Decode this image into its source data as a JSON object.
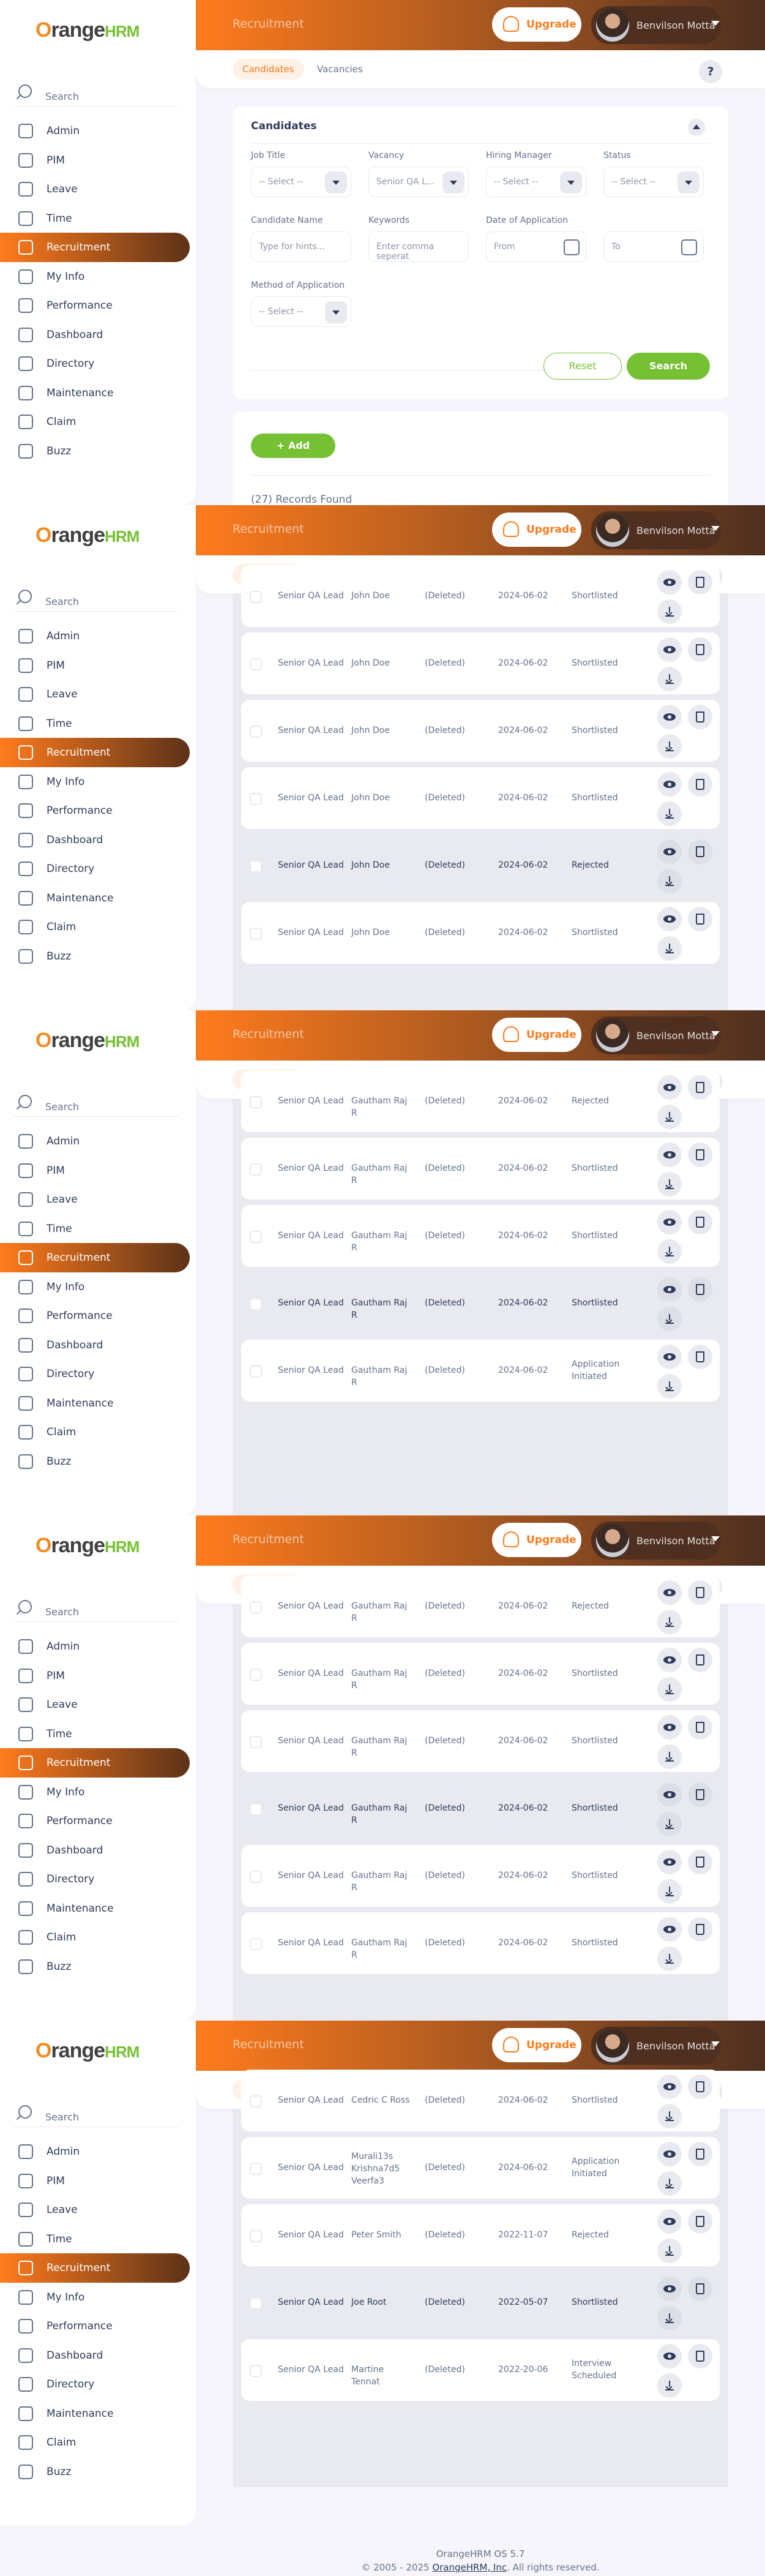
{
  "app": {
    "brand_word": "range",
    "brand_suffix": "HRM",
    "module_title": "Recruitment",
    "upgrade_label": "Upgrade",
    "user_name": "Benvilson Motta",
    "help_label": "?",
    "search_placeholder": "Search",
    "menu": [
      "Admin",
      "PIM",
      "Leave",
      "Time",
      "Recruitment",
      "My Info",
      "Performance",
      "Dashboard",
      "Directory",
      "Maintenance",
      "Claim",
      "Buzz"
    ],
    "active_menu": "Recruitment",
    "tabs": [
      "Candidates",
      "Vacancies"
    ]
  },
  "filters": {
    "title": "Candidates",
    "job_title_label": "Job Title",
    "job_title_value": "-- Select --",
    "vacancy_label": "Vacancy",
    "vacancy_value": "Senior QA L...",
    "hiring_manager_label": "Hiring Manager",
    "hiring_manager_value": "-- Select --",
    "status_label": "Status",
    "status_value": "-- Select --",
    "candidate_name_label": "Candidate Name",
    "candidate_name_placeholder": "Type for hints...",
    "keywords_label": "Keywords",
    "keywords_placeholder": "Enter comma seperat",
    "date_label": "Date of Application",
    "date_from": "From",
    "date_to": "To",
    "method_label": "Method of Application",
    "method_value": "-- Select --",
    "reset_label": "Reset",
    "search_label": "Search"
  },
  "list": {
    "add_label": "+ Add",
    "records_found": "(27) Records Found"
  },
  "frames": [
    {
      "rows": []
    },
    {
      "rows": [
        [
          "Senior QA Lead",
          "John Doe",
          "(Deleted)",
          "2024-06-02",
          "Shortlisted"
        ],
        [
          "Senior QA Lead",
          "John Doe",
          "(Deleted)",
          "2024-06-02",
          "Shortlisted"
        ],
        [
          "Senior QA Lead",
          "John Doe",
          "(Deleted)",
          "2024-06-02",
          "Shortlisted"
        ],
        [
          "Senior QA Lead",
          "John Doe",
          "(Deleted)",
          "2024-06-02",
          "Shortlisted"
        ],
        [
          "Senior QA Lead",
          "John Doe",
          "(Deleted)",
          "2024-06-02",
          "Rejected"
        ],
        [
          "Senior QA Lead",
          "John Doe",
          "(Deleted)",
          "2024-06-02",
          "Shortlisted"
        ]
      ]
    },
    {
      "rows": [
        [
          "Senior QA Lead",
          "Gautham Raj R",
          "(Deleted)",
          "2024-06-02",
          "Rejected"
        ],
        [
          "Senior QA Lead",
          "Gautham Raj R",
          "(Deleted)",
          "2024-06-02",
          "Shortlisted"
        ],
        [
          "Senior QA Lead",
          "Gautham Raj R",
          "(Deleted)",
          "2024-06-02",
          "Shortlisted"
        ],
        [
          "Senior QA Lead",
          "Gautham Raj R",
          "(Deleted)",
          "2024-06-02",
          "Shortlisted"
        ],
        [
          "Senior QA Lead",
          "Gautham Raj R",
          "(Deleted)",
          "2024-06-02",
          "Application Initiated"
        ]
      ]
    },
    {
      "rows": [
        [
          "Senior QA Lead",
          "Gautham Raj R",
          "(Deleted)",
          "2024-06-02",
          "Rejected"
        ],
        [
          "Senior QA Lead",
          "Gautham Raj R",
          "(Deleted)",
          "2024-06-02",
          "Shortlisted"
        ],
        [
          "Senior QA Lead",
          "Gautham Raj R",
          "(Deleted)",
          "2024-06-02",
          "Shortlisted"
        ],
        [
          "Senior QA Lead",
          "Gautham Raj R",
          "(Deleted)",
          "2024-06-02",
          "Shortlisted"
        ],
        [
          "Senior QA Lead",
          "Gautham Raj R",
          "(Deleted)",
          "2024-06-02",
          "Shortlisted"
        ],
        [
          "Senior QA Lead",
          "Gautham Raj R",
          "(Deleted)",
          "2024-06-02",
          "Shortlisted"
        ]
      ]
    },
    {
      "rows": [
        [
          "Senior QA Lead",
          "Cedric C Ross",
          "(Deleted)",
          "2024-06-02",
          "Shortlisted"
        ],
        [
          "Senior QA Lead",
          "Murali13s Krishna7d5 Veerfa3",
          "(Deleted)",
          "2024-06-02",
          "Application Initiated"
        ],
        [
          "Senior QA Lead",
          "Peter Smith",
          "(Deleted)",
          "2022-11-07",
          "Rejected"
        ],
        [
          "Senior QA Lead",
          "Joe Root",
          "(Deleted)",
          "2022-05-07",
          "Shortlisted"
        ],
        [
          "Senior QA Lead",
          "Martine Tennat",
          "(Deleted)",
          "2022-20-06",
          "Interview Scheduled"
        ]
      ]
    }
  ],
  "footer": {
    "version": "OrangeHRM OS 5.7",
    "copyright_prefix": "© 2005 - 2025",
    "company": "OrangeHRM, Inc",
    "copyright_suffix": ". All rights reserved."
  },
  "colors": {
    "accent": "#ff7b1d",
    "green": "#75c033",
    "topbar_dark": "#4e2f1f"
  }
}
